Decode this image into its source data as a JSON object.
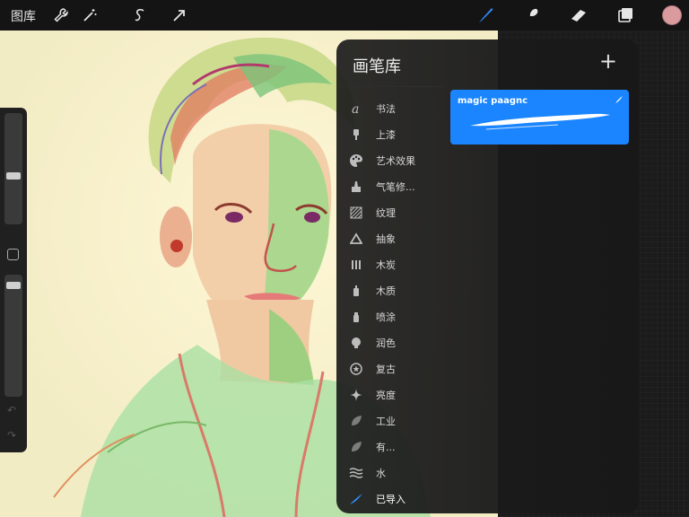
{
  "toolbar": {
    "gallery_label": "图库",
    "left_tools": [
      "wrench-icon",
      "magic-wand-icon",
      "selection-icon",
      "transform-arrow-icon"
    ],
    "right_tools": [
      "brush-icon",
      "smudge-icon",
      "eraser-icon",
      "layers-icon"
    ],
    "current_color": "#d99b9e",
    "active_tool": "brush"
  },
  "sidebar": {
    "brush_size_level": 0.55,
    "opacity_level": 0.05
  },
  "brush_library": {
    "title": "画笔库",
    "add_label": "+",
    "sets": [
      {
        "label": "书法",
        "icon": "calligraphy-icon"
      },
      {
        "label": "上漆",
        "icon": "paint-brush-icon"
      },
      {
        "label": "艺术效果",
        "icon": "palette-icon"
      },
      {
        "label": "气笔修...",
        "icon": "airbrush-icon"
      },
      {
        "label": "纹理",
        "icon": "texture-icon"
      },
      {
        "label": "抽象",
        "icon": "triangle-icon"
      },
      {
        "label": "木炭",
        "icon": "charcoal-icon"
      },
      {
        "label": "木质",
        "icon": "spray-can-icon"
      },
      {
        "label": "喷涂",
        "icon": "spray-bottle-icon"
      },
      {
        "label": "润色",
        "icon": "lightbulb-icon"
      },
      {
        "label": "复古",
        "icon": "star-badge-icon"
      },
      {
        "label": "亮度",
        "icon": "sparkle-icon"
      },
      {
        "label": "工业",
        "icon": "leaf-icon"
      },
      {
        "label": "有...",
        "icon": "leaf-icon"
      },
      {
        "label": "水",
        "icon": "water-waves-icon"
      },
      {
        "label": "已导入",
        "icon": "imported-brush-icon"
      }
    ],
    "selected_set": "已导入",
    "brushes": [
      {
        "name": "magic paagnc",
        "accent": "#1a85ff"
      }
    ]
  }
}
